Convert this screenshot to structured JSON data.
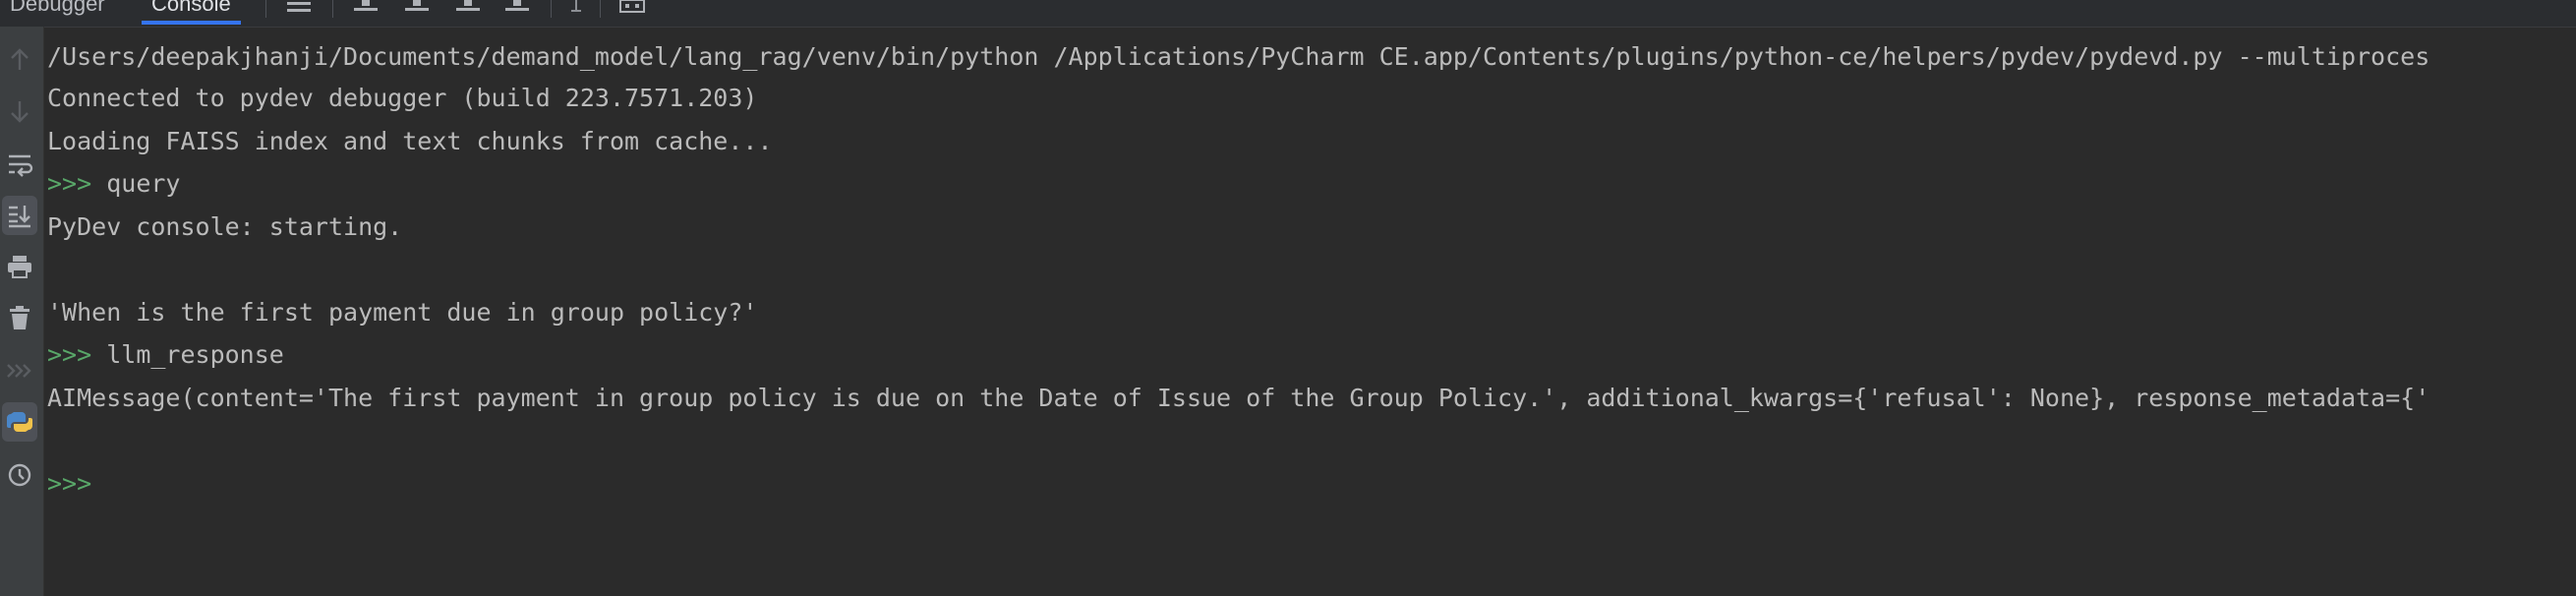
{
  "tabs": [
    {
      "label": "Debugger"
    },
    {
      "label": "Console"
    }
  ],
  "gutter": {
    "buttons": [
      "arrow-up-icon",
      "arrow-down-icon",
      "soft-wrap-icon",
      "scroll-to-end-icon",
      "print-icon",
      "trash-icon",
      "execute-icon",
      "python-console-icon",
      "history-icon"
    ]
  },
  "console": {
    "lines": [
      {
        "text": "/Users/deepakjhanji/Documents/demand_model/lang_rag/venv/bin/python /Applications/PyCharm CE.app/Contents/plugins/python-ce/helpers/pydev/pydevd.py --multiproces"
      },
      {
        "text": "Connected to pydev debugger (build 223.7571.203)"
      },
      {
        "text": "Loading FAISS index and text chunks from cache..."
      },
      {
        "prompt": ">>> ",
        "text": "query"
      },
      {
        "text": "PyDev console: starting."
      },
      {
        "text": ""
      },
      {
        "text": "'When is the first payment due in group policy?'"
      },
      {
        "prompt": ">>> ",
        "text": "llm_response"
      },
      {
        "text": "AIMessage(content='The first payment in group policy is due on the Date of Issue of the Group Policy.', additional_kwargs={'refusal': None}, response_metadata={'"
      },
      {
        "text": ""
      },
      {
        "prompt": ">>>",
        "text": ""
      }
    ]
  }
}
